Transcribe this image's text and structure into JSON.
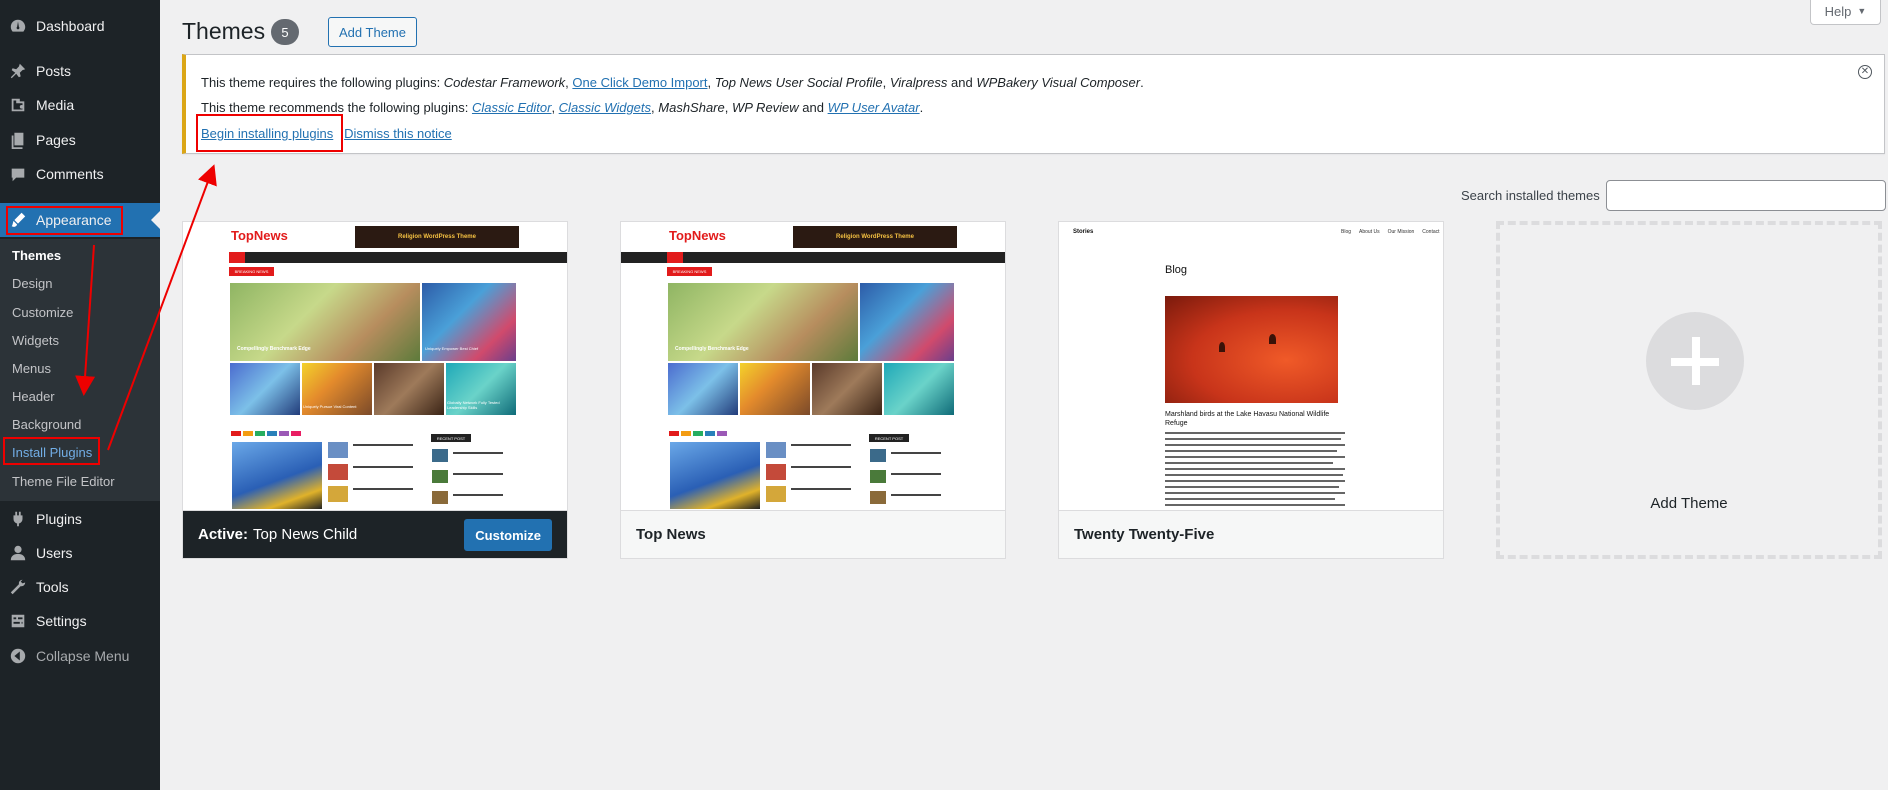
{
  "sidebar": {
    "items": [
      {
        "label": "Dashboard",
        "icon": "dashboard-icon"
      },
      {
        "label": "Posts",
        "icon": "pin-icon"
      },
      {
        "label": "Media",
        "icon": "media-icon"
      },
      {
        "label": "Pages",
        "icon": "pages-icon"
      },
      {
        "label": "Comments",
        "icon": "comments-icon"
      },
      {
        "label": "Appearance",
        "icon": "brush-icon"
      },
      {
        "label": "Plugins",
        "icon": "plug-icon"
      },
      {
        "label": "Users",
        "icon": "user-icon"
      },
      {
        "label": "Tools",
        "icon": "wrench-icon"
      },
      {
        "label": "Settings",
        "icon": "settings-icon"
      },
      {
        "label": "Collapse Menu",
        "icon": "collapse-icon"
      }
    ],
    "submenu": [
      "Themes",
      "Design",
      "Customize",
      "Widgets",
      "Menus",
      "Header",
      "Background",
      "Install Plugins",
      "Theme File Editor"
    ]
  },
  "header": {
    "title": "Themes",
    "count": "5",
    "add_theme": "Add Theme",
    "help": "Help"
  },
  "notice": {
    "line1_prefix": "This theme requires the following plugins: ",
    "line1_p1": "Codestar Framework",
    "line1_sep1": ", ",
    "line1_p2": "One Click Demo Import",
    "line1_sep2": ", ",
    "line1_p3": "Top News User Social Profile",
    "line1_sep3": ", ",
    "line1_p4": "Viralpress",
    "line1_and": " and ",
    "line1_p5": "WPBakery Visual Composer",
    "line1_end": ".",
    "line2_prefix": "This theme recommends the following plugins: ",
    "line2_p1": "Classic Editor",
    "line2_sep1": ", ",
    "line2_p2": "Classic Widgets",
    "line2_sep2": ", ",
    "line2_p3": "MashShare",
    "line2_sep3": ", ",
    "line2_p4": "WP Review",
    "line2_and": " and ",
    "line2_p5": "WP User Avatar",
    "line2_end": ".",
    "begin": "Begin installing plugins",
    "dismiss": "Dismiss this notice"
  },
  "search": {
    "label": "Search installed themes",
    "value": ""
  },
  "themes": [
    {
      "active_label": "Active:",
      "name": "Top News Child",
      "action": "Customize"
    },
    {
      "name": "Top News"
    },
    {
      "name": "Twenty Twenty-Five"
    }
  ],
  "add_theme_card": "Add Theme",
  "preview_topnews": {
    "logo": "TopNews",
    "banner": "Religion WordPress Theme",
    "breaking": "BREAKING NEWS",
    "headline1": "Compellingly Benchmark Edge",
    "headline2": "Uniquely Empower Best Chief",
    "headline3": "Uniquely Pursue Viral Content",
    "headline4": "Globally Network Fully Tested Leadership Skills",
    "recent": "RECENT POST"
  },
  "preview_tt5": {
    "site": "Stories",
    "nav": [
      "Blog",
      "About Us",
      "Our Mission",
      "Contact"
    ],
    "heading": "Blog",
    "caption": "Marshland birds at the Lake Havasu National Wildlife Refuge"
  },
  "colors": {
    "sidebar": "#1d2327",
    "accent": "#2271b1",
    "notice_border": "#dba617",
    "annotation": "#ee0000"
  }
}
